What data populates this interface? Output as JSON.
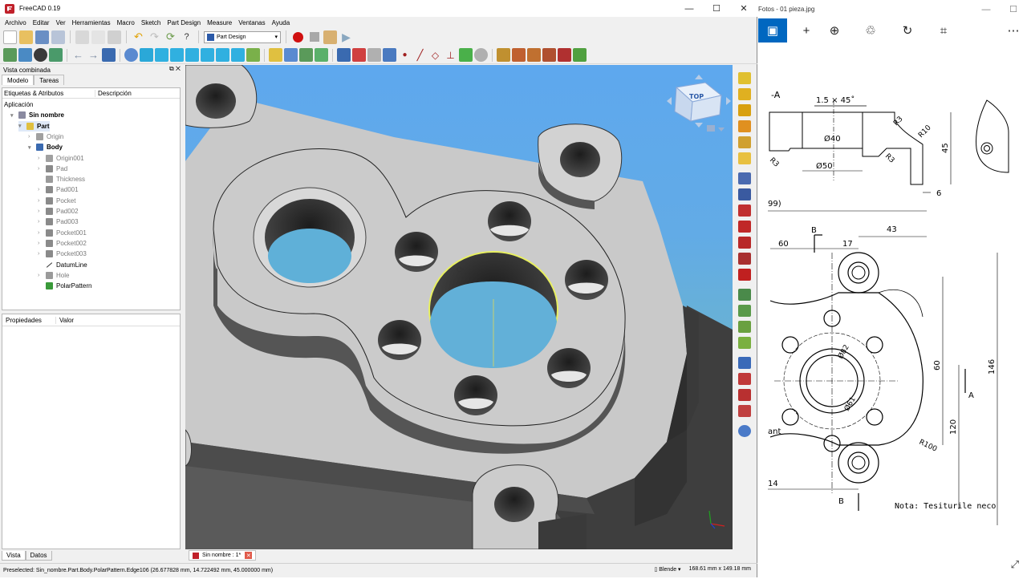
{
  "freecad": {
    "title": "FreeCAD 0.19",
    "window_buttons": [
      "—",
      "☐",
      "✕"
    ],
    "menu": [
      "Archivo",
      "Editar",
      "Ver",
      "Herramientas",
      "Macro",
      "Sketch",
      "Part Design",
      "Measure",
      "Ventanas",
      "Ayuda"
    ],
    "workbench": "Part Design",
    "combo": {
      "title": "Vista combinada",
      "tabs": [
        "Modelo",
        "Tareas"
      ],
      "tree_headers": [
        "Etiquetas & Atributos",
        "Descripción"
      ],
      "tree": [
        {
          "label": "Aplicación",
          "level": 0,
          "style": "plain",
          "icon": "",
          "arrow": ""
        },
        {
          "label": "Sin nombre",
          "level": 1,
          "style": "bold",
          "icon": "document",
          "arrow": "▾"
        },
        {
          "label": "Part",
          "level": 2,
          "style": "bold sel",
          "icon": "part",
          "arrow": "▾"
        },
        {
          "label": "Origin",
          "level": 3,
          "style": "grey",
          "icon": "origin",
          "arrow": "›"
        },
        {
          "label": "Body",
          "level": 3,
          "style": "bold",
          "icon": "body",
          "arrow": "▾"
        },
        {
          "label": "Origin001",
          "level": 4,
          "style": "grey",
          "icon": "origin",
          "arrow": "›"
        },
        {
          "label": "Pad",
          "level": 4,
          "style": "grey",
          "icon": "pad",
          "arrow": "›"
        },
        {
          "label": "Thickness",
          "level": 4,
          "style": "grey",
          "icon": "thickness",
          "arrow": ""
        },
        {
          "label": "Pad001",
          "level": 4,
          "style": "grey",
          "icon": "pad",
          "arrow": "›"
        },
        {
          "label": "Pocket",
          "level": 4,
          "style": "grey",
          "icon": "pocket",
          "arrow": "›"
        },
        {
          "label": "Pad002",
          "level": 4,
          "style": "grey",
          "icon": "pad",
          "arrow": "›"
        },
        {
          "label": "Pad003",
          "level": 4,
          "style": "grey",
          "icon": "pad",
          "arrow": "›"
        },
        {
          "label": "Pocket001",
          "level": 4,
          "style": "grey",
          "icon": "pocket",
          "arrow": "›"
        },
        {
          "label": "Pocket002",
          "level": 4,
          "style": "grey",
          "icon": "pocket",
          "arrow": "›"
        },
        {
          "label": "Pocket003",
          "level": 4,
          "style": "grey",
          "icon": "pocket",
          "arrow": "›"
        },
        {
          "label": "DatumLine",
          "level": 4,
          "style": "plain",
          "icon": "datumline",
          "arrow": ""
        },
        {
          "label": "Hole",
          "level": 4,
          "style": "grey",
          "icon": "hole",
          "arrow": "›"
        },
        {
          "label": "PolarPattern",
          "level": 4,
          "style": "plain",
          "icon": "polarpattern",
          "arrow": ""
        }
      ],
      "prop_headers": [
        "Propiedades",
        "Valor"
      ],
      "bottom_tabs": [
        "Vista",
        "Datos"
      ]
    },
    "navcube_face": "TOP",
    "doc_tab": "Sin nombre : 1*",
    "status": {
      "preselected": "Preselected: Sin_nombre.Part.Body.PolarPattern.Edge106 (26.677828 mm, 14.722492 mm, 45.000000 mm)",
      "nav_style": "Blende",
      "dimensions": "168.61 mm x 149.18 mm"
    },
    "colors": {
      "accent": "#2b5aa8",
      "sky_top": "#5ea8ee",
      "sky_bottom": "#79bfae",
      "part": "#c8c8c8",
      "highlight": "#e8f060"
    }
  },
  "photos": {
    "title": "Fotos - 01 pieza.jpg",
    "toolbar": [
      {
        "icon": "image-icon",
        "glyph": "▣"
      },
      {
        "icon": "plus-icon",
        "glyph": "+"
      },
      {
        "icon": "zoom-in-icon",
        "glyph": "⊕"
      },
      {
        "icon": "delete-icon",
        "glyph": "♲"
      },
      {
        "icon": "rotate-icon",
        "glyph": "↻"
      },
      {
        "icon": "crop-icon",
        "glyph": "⌗"
      },
      {
        "icon": "more-icon",
        "glyph": "⋯"
      }
    ],
    "drawing_labels": {
      "section": "-A",
      "chamfer": "1.5 × 45˚",
      "d40": "Ø40",
      "d50": "Ø50",
      "r3a": "R3",
      "r3b": "R3",
      "r3c": "R3",
      "r10": "R10",
      "dim45": "45",
      "dim6": "6",
      "dim99": "99)",
      "b_top": "B",
      "dim60": "60",
      "dim17": "17",
      "dim43": "43",
      "d82": "Ø82",
      "d61": "Ø61",
      "dim60v": "60",
      "dim120": "120",
      "dim146": "146",
      "a_label": "A",
      "r100": "R100",
      "ant": "ant",
      "dim14": "14",
      "b_bottom": "B",
      "nota": "Nota: Tesiturile neco"
    }
  }
}
